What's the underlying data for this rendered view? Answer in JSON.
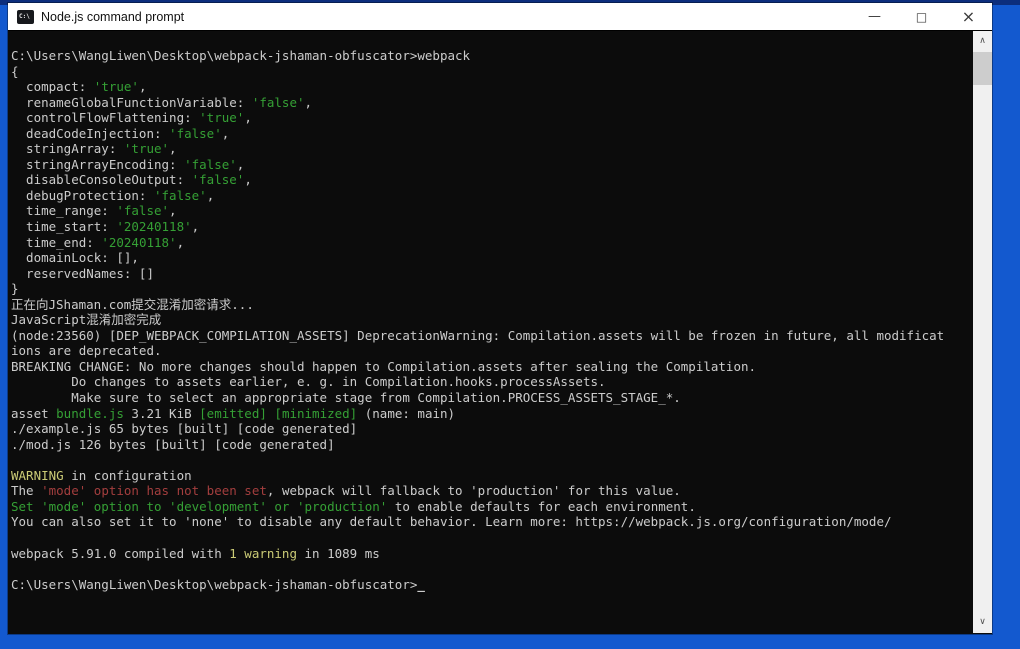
{
  "window": {
    "title": "Node.js command prompt",
    "icon_label": "C:\\",
    "controls": {
      "minimize": "—",
      "maximize": "□",
      "close": "×"
    }
  },
  "scrollbar": {
    "up_glyph": "∧",
    "down_glyph": "∨"
  },
  "colors": {
    "desktop": "#1359cf",
    "terminal_background": "#0c0c0c",
    "default_text": "#cccccc",
    "green": "#35a035",
    "red": "#a33e3e",
    "yellow": "#cbcb76",
    "titlebar": "#ffffff"
  },
  "terminal": {
    "lines": [
      {
        "segments": [
          {
            "t": "C:\\Users\\WangLiwen\\Desktop\\webpack-jshaman-obfuscator>webpack"
          }
        ]
      },
      {
        "segments": [
          {
            "t": "{"
          }
        ]
      },
      {
        "segments": [
          {
            "t": "  compact: "
          },
          {
            "t": "'true'",
            "c": "green"
          },
          {
            "t": ","
          }
        ]
      },
      {
        "segments": [
          {
            "t": "  renameGlobalFunctionVariable: "
          },
          {
            "t": "'false'",
            "c": "green"
          },
          {
            "t": ","
          }
        ]
      },
      {
        "segments": [
          {
            "t": "  controlFlowFlattening: "
          },
          {
            "t": "'true'",
            "c": "green"
          },
          {
            "t": ","
          }
        ]
      },
      {
        "segments": [
          {
            "t": "  deadCodeInjection: "
          },
          {
            "t": "'false'",
            "c": "green"
          },
          {
            "t": ","
          }
        ]
      },
      {
        "segments": [
          {
            "t": "  stringArray: "
          },
          {
            "t": "'true'",
            "c": "green"
          },
          {
            "t": ","
          }
        ]
      },
      {
        "segments": [
          {
            "t": "  stringArrayEncoding: "
          },
          {
            "t": "'false'",
            "c": "green"
          },
          {
            "t": ","
          }
        ]
      },
      {
        "segments": [
          {
            "t": "  disableConsoleOutput: "
          },
          {
            "t": "'false'",
            "c": "green"
          },
          {
            "t": ","
          }
        ]
      },
      {
        "segments": [
          {
            "t": "  debugProtection: "
          },
          {
            "t": "'false'",
            "c": "green"
          },
          {
            "t": ","
          }
        ]
      },
      {
        "segments": [
          {
            "t": "  time_range: "
          },
          {
            "t": "'false'",
            "c": "green"
          },
          {
            "t": ","
          }
        ]
      },
      {
        "segments": [
          {
            "t": "  time_start: "
          },
          {
            "t": "'20240118'",
            "c": "green"
          },
          {
            "t": ","
          }
        ]
      },
      {
        "segments": [
          {
            "t": "  time_end: "
          },
          {
            "t": "'20240118'",
            "c": "green"
          },
          {
            "t": ","
          }
        ]
      },
      {
        "segments": [
          {
            "t": "  domainLock: [],"
          }
        ]
      },
      {
        "segments": [
          {
            "t": "  reservedNames: []"
          }
        ]
      },
      {
        "segments": [
          {
            "t": "}"
          }
        ]
      },
      {
        "segments": [
          {
            "t": "正在向JShaman.com提交混淆加密请求..."
          }
        ]
      },
      {
        "segments": [
          {
            "t": "JavaScript混淆加密完成"
          }
        ]
      },
      {
        "segments": [
          {
            "t": "(node:23560) [DEP_WEBPACK_COMPILATION_ASSETS] DeprecationWarning: Compilation.assets will be frozen in future, all modificat"
          }
        ]
      },
      {
        "segments": [
          {
            "t": "ions are deprecated."
          }
        ]
      },
      {
        "segments": [
          {
            "t": "BREAKING CHANGE: No more changes should happen to Compilation.assets after sealing the Compilation."
          }
        ]
      },
      {
        "segments": [
          {
            "t": "        Do changes to assets earlier, e. g. in Compilation.hooks.processAssets."
          }
        ]
      },
      {
        "segments": [
          {
            "t": "        Make sure to select an appropriate stage from Compilation.PROCESS_ASSETS_STAGE_*."
          }
        ]
      },
      {
        "segments": [
          {
            "t": "asset "
          },
          {
            "t": "bundle.js",
            "c": "green"
          },
          {
            "t": " 3.21 KiB "
          },
          {
            "t": "[emitted]",
            "c": "green"
          },
          {
            "t": " "
          },
          {
            "t": "[minimized]",
            "c": "green"
          },
          {
            "t": " (name: main)"
          }
        ]
      },
      {
        "segments": [
          {
            "t": "./example.js 65 bytes [built] [code generated]"
          }
        ]
      },
      {
        "segments": [
          {
            "t": "./mod.js 126 bytes [built] [code generated]"
          }
        ]
      },
      {
        "segments": []
      },
      {
        "segments": [
          {
            "t": "WARNING",
            "c": "yellow"
          },
          {
            "t": " in configuration"
          }
        ]
      },
      {
        "segments": [
          {
            "t": "The "
          },
          {
            "t": "'mode' option has not been set",
            "c": "red"
          },
          {
            "t": ", webpack will fallback to 'production' for this value."
          }
        ]
      },
      {
        "segments": [
          {
            "t": "Set 'mode' option to 'development' or 'production'",
            "c": "green"
          },
          {
            "t": " to enable defaults for each environment."
          }
        ]
      },
      {
        "segments": [
          {
            "t": "You can also set it to 'none' to disable any default behavior. Learn more: https://webpack.js.org/configuration/mode/"
          }
        ]
      },
      {
        "segments": []
      },
      {
        "segments": [
          {
            "t": "webpack 5.91.0 compiled with "
          },
          {
            "t": "1 warning",
            "c": "yellow"
          },
          {
            "t": " in 1089 ms"
          }
        ]
      },
      {
        "segments": []
      },
      {
        "segments": [
          {
            "t": "C:\\Users\\WangLiwen\\Desktop\\webpack-jshaman-obfuscator>"
          },
          {
            "t": "_",
            "c": "cursor"
          }
        ]
      }
    ]
  }
}
